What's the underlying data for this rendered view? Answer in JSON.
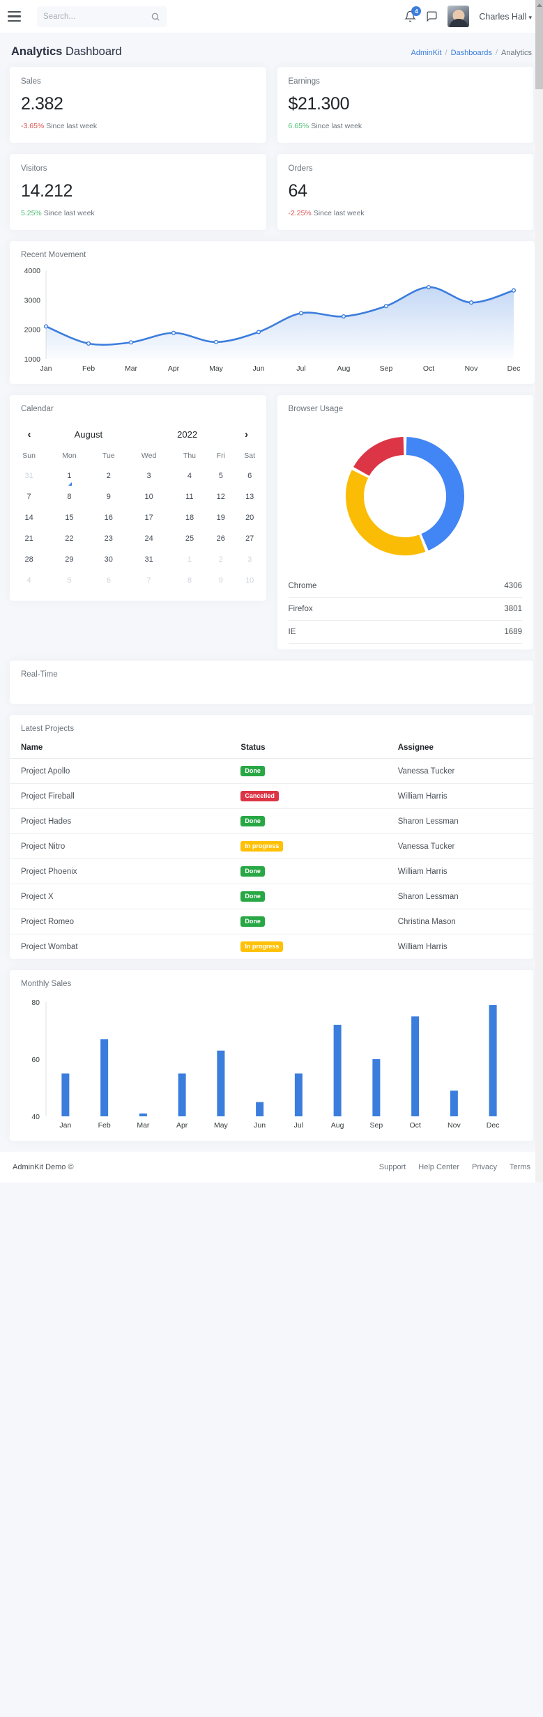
{
  "navbar": {
    "menu_icon": "hamburger-icon",
    "search_placeholder": "Search...",
    "search_value": "",
    "notifications_count": "4",
    "user_name": "Charles Hall",
    "caret": "⌄"
  },
  "header": {
    "title_bold": "Analytics",
    "title_rest": " Dashboard",
    "breadcrumb": [
      "AdminKit",
      "Dashboards",
      "Analytics"
    ],
    "breadcrumb_sep": "/"
  },
  "stats": [
    {
      "label": "Sales",
      "value": "2.382",
      "pct": "-3.65%",
      "pct_dir": "down",
      "sub": "Since last week"
    },
    {
      "label": "Earnings",
      "value": "$21.300",
      "pct": "6.65%",
      "pct_dir": "up",
      "sub": "Since last week"
    },
    {
      "label": "Visitors",
      "value": "14.212",
      "pct": "5.25%",
      "pct_dir": "up",
      "sub": "Since last week"
    },
    {
      "label": "Orders",
      "value": "64",
      "pct": "-2.25%",
      "pct_dir": "down",
      "sub": "Since last week"
    }
  ],
  "calendar": {
    "title": "Calendar",
    "prev_icon": "chevron-left-icon",
    "next_icon": "chevron-right-icon",
    "month": "August",
    "year": "2022",
    "weekdays": [
      "Sun",
      "Mon",
      "Tue",
      "Wed",
      "Thu",
      "Fri",
      "Sat"
    ],
    "weeks": [
      [
        {
          "d": "31",
          "m": true
        },
        {
          "d": "1",
          "marked": true
        },
        {
          "d": "2"
        },
        {
          "d": "3"
        },
        {
          "d": "4"
        },
        {
          "d": "5"
        },
        {
          "d": "6"
        }
      ],
      [
        {
          "d": "7"
        },
        {
          "d": "8"
        },
        {
          "d": "9"
        },
        {
          "d": "10"
        },
        {
          "d": "11"
        },
        {
          "d": "12"
        },
        {
          "d": "13"
        }
      ],
      [
        {
          "d": "14"
        },
        {
          "d": "15"
        },
        {
          "d": "16"
        },
        {
          "d": "17"
        },
        {
          "d": "18"
        },
        {
          "d": "19"
        },
        {
          "d": "20"
        }
      ],
      [
        {
          "d": "21"
        },
        {
          "d": "22"
        },
        {
          "d": "23"
        },
        {
          "d": "24"
        },
        {
          "d": "25"
        },
        {
          "d": "26"
        },
        {
          "d": "27"
        }
      ],
      [
        {
          "d": "28"
        },
        {
          "d": "29"
        },
        {
          "d": "30"
        },
        {
          "d": "31"
        },
        {
          "d": "1",
          "m": true
        },
        {
          "d": "2",
          "m": true
        },
        {
          "d": "3",
          "m": true
        }
      ],
      [
        {
          "d": "4",
          "m": true
        },
        {
          "d": "5",
          "m": true
        },
        {
          "d": "6",
          "m": true
        },
        {
          "d": "7",
          "m": true
        },
        {
          "d": "8",
          "m": true
        },
        {
          "d": "9",
          "m": true
        },
        {
          "d": "10",
          "m": true
        }
      ]
    ]
  },
  "browser_usage": {
    "title": "Browser Usage",
    "rows": [
      {
        "name": "Chrome",
        "value": "4306"
      },
      {
        "name": "Firefox",
        "value": "3801"
      },
      {
        "name": "IE",
        "value": "1689"
      }
    ]
  },
  "realtime": {
    "title": "Real-Time"
  },
  "projects": {
    "title": "Latest Projects",
    "columns": [
      "Name",
      "Status",
      "Assignee"
    ],
    "rows": [
      {
        "name": "Project Apollo",
        "status": "Done",
        "status_kind": "done",
        "assignee": "Vanessa Tucker"
      },
      {
        "name": "Project Fireball",
        "status": "Cancelled",
        "status_kind": "cancelled",
        "assignee": "William Harris"
      },
      {
        "name": "Project Hades",
        "status": "Done",
        "status_kind": "done",
        "assignee": "Sharon Lessman"
      },
      {
        "name": "Project Nitro",
        "status": "In progress",
        "status_kind": "progress",
        "assignee": "Vanessa Tucker"
      },
      {
        "name": "Project Phoenix",
        "status": "Done",
        "status_kind": "done",
        "assignee": "William Harris"
      },
      {
        "name": "Project X",
        "status": "Done",
        "status_kind": "done",
        "assignee": "Sharon Lessman"
      },
      {
        "name": "Project Romeo",
        "status": "Done",
        "status_kind": "done",
        "assignee": "Christina Mason"
      },
      {
        "name": "Project Wombat",
        "status": "In progress",
        "status_kind": "progress",
        "assignee": "William Harris"
      }
    ]
  },
  "footer": {
    "copyright": "AdminKit Demo ©",
    "links": [
      "Support",
      "Help Center",
      "Privacy",
      "Terms"
    ]
  },
  "colors": {
    "primary": "#3b7ddd",
    "success": "#28a745",
    "danger": "#dc3545",
    "warning": "#ffc107",
    "chrome": "#4285f4",
    "firefox": "#fbbc05",
    "ie": "#dc3545"
  },
  "chart_data": [
    {
      "type": "area",
      "title": "Recent Movement",
      "categories": [
        "Jan",
        "Feb",
        "Mar",
        "Apr",
        "May",
        "Jun",
        "Jul",
        "Aug",
        "Sep",
        "Oct",
        "Nov",
        "Dec"
      ],
      "values": [
        2100,
        1520,
        1560,
        1880,
        1570,
        1910,
        2550,
        2440,
        2790,
        3430,
        2910,
        3320
      ],
      "yticks": [
        1000,
        2000,
        3000,
        4000
      ],
      "ylim": [
        1000,
        4000
      ],
      "xlabel": "",
      "ylabel": "",
      "grid": false,
      "legend": "none",
      "series_color": "#3b7ddd"
    },
    {
      "type": "pie",
      "title": "Browser Usage",
      "labels": [
        "Chrome",
        "Firefox",
        "IE"
      ],
      "values": [
        4306,
        3801,
        1689
      ],
      "colors": [
        "#4285f4",
        "#fbbc05",
        "#dc3545"
      ],
      "donut": true,
      "legend": "none"
    },
    {
      "type": "bar",
      "title": "Monthly Sales",
      "categories": [
        "Jan",
        "Feb",
        "Mar",
        "Apr",
        "May",
        "Jun",
        "Jul",
        "Aug",
        "Sep",
        "Oct",
        "Nov",
        "Dec"
      ],
      "values": [
        55,
        67,
        41,
        55,
        63,
        45,
        55,
        72,
        60,
        75,
        49,
        79
      ],
      "yticks": [
        40,
        60,
        80
      ],
      "ylim": [
        40,
        80
      ],
      "xlabel": "",
      "ylabel": "",
      "grid": false,
      "legend": "none",
      "series_color": "#3b7ddd"
    }
  ]
}
